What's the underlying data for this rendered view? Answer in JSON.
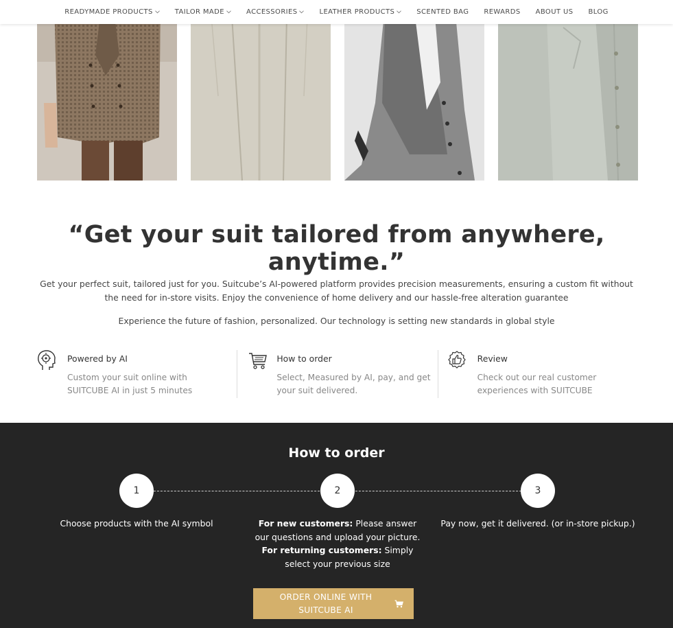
{
  "nav": {
    "items": [
      {
        "label": "READYMADE PRODUCTS",
        "dropdown": true
      },
      {
        "label": "TAILOR MADE",
        "dropdown": true
      },
      {
        "label": "ACCESSORIES",
        "dropdown": true
      },
      {
        "label": "LEATHER PRODUCTS",
        "dropdown": true
      },
      {
        "label": "SCENTED BAG",
        "dropdown": false
      },
      {
        "label": "REWARDS",
        "dropdown": false
      },
      {
        "label": "ABOUT US",
        "dropdown": false
      },
      {
        "label": "BLOG",
        "dropdown": false
      }
    ]
  },
  "gallery": {
    "images": [
      {
        "name": "double-breasted-blazer-photo"
      },
      {
        "name": "pleated-trousers-photo"
      },
      {
        "name": "grey-waistcoat-photo"
      },
      {
        "name": "light-shirt-photo"
      }
    ]
  },
  "headline": "“Get your suit tailored from anywhere, anytime.”",
  "intro": {
    "paragraph1": "Get your perfect suit, tailored just for you. Suitcube’s AI-powered platform provides precision measurements, ensuring a custom fit without the need for in-store visits. Enjoy the convenience of home delivery and our hassle-free alteration guarantee",
    "paragraph2": "Experience the future of fashion, personalized. Our technology is setting new standards in global style"
  },
  "features": [
    {
      "icon": "ai-head-icon",
      "title": "Powered by AI",
      "description": "Custom your suit online with SUITCUBE AI in just 5 minutes"
    },
    {
      "icon": "cart-icon",
      "title": "How to order",
      "description": "Select, Measured by AI, pay, and get your suit delivered."
    },
    {
      "icon": "thumbs-up-icon",
      "title": "Review",
      "description": "Check out our real customer experiences with SUITCUBE"
    }
  ],
  "how_to_order": {
    "title": "How to order",
    "steps": [
      {
        "number": "1",
        "text": "Choose products with the AI symbol"
      },
      {
        "number": "2",
        "new_label": "For new customers:",
        "new_text": " Please answer our questions and upload your picture. ",
        "returning_label": "For returning customers:",
        "returning_text": " Simply select your previous size"
      },
      {
        "number": "3",
        "text": "Pay now, get it delivered. (or in-store pickup.)"
      }
    ],
    "button_label": "ORDER ONLINE WITH SUITCUBE AI"
  },
  "colors": {
    "dark_section": "#252525",
    "accent_gold": "#d4b06b",
    "text_dark": "#333333",
    "text_muted": "#888888"
  }
}
